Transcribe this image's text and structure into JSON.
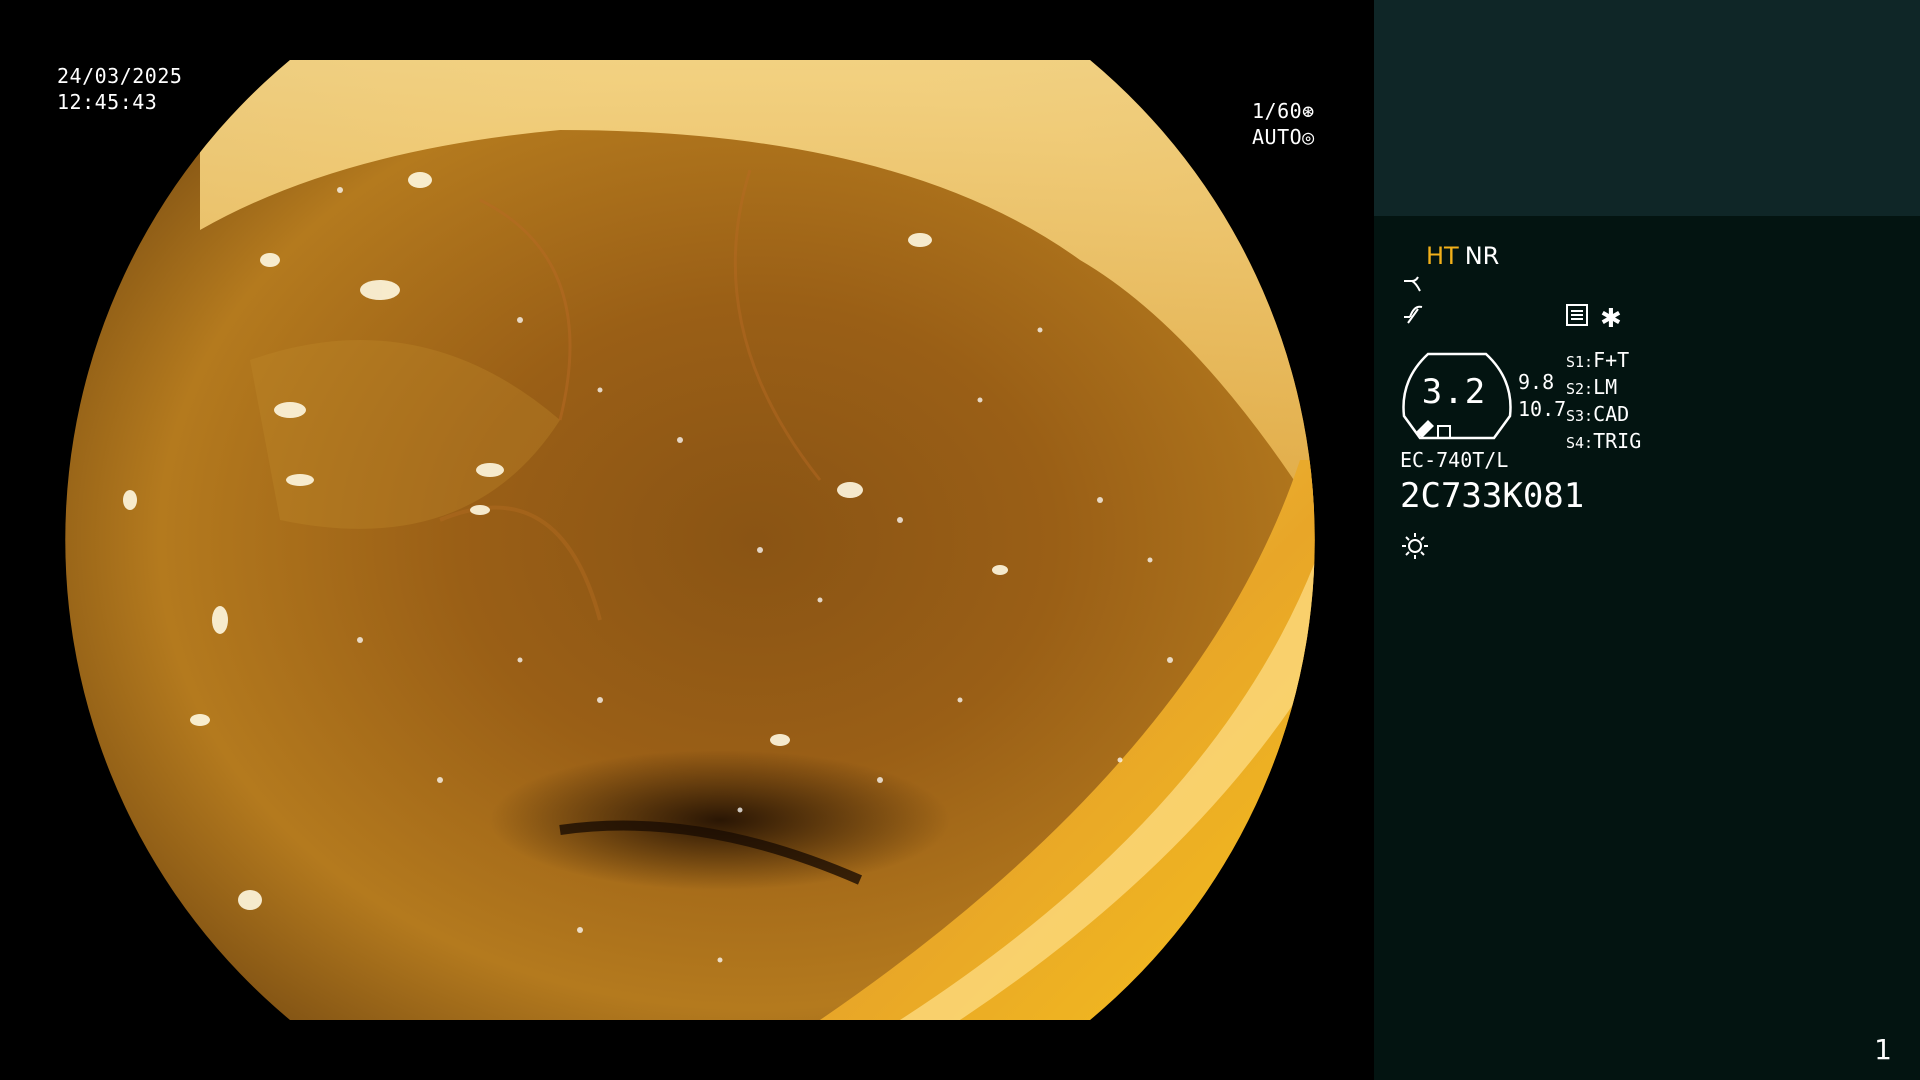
{
  "overlay": {
    "date": "24/03/2025",
    "time": "12:45:43",
    "shutter": "1/60",
    "iris": "AUTO"
  },
  "panel": {
    "mode_ht": "HT",
    "mode_nr": "NR",
    "zoom": "3.2",
    "param_1": "9.8",
    "param_2": "10.7",
    "switches": [
      {
        "key": "S1:",
        "value": "F+T"
      },
      {
        "key": "S2:",
        "value": "LM"
      },
      {
        "key": "S3:",
        "value": "CAD"
      },
      {
        "key": "S4:",
        "value": "TRIG"
      }
    ],
    "scope_model": "EC-740T/L",
    "scope_serial": "2C733K081",
    "frame_number": "1"
  },
  "icons": {
    "enhance": "enhancement-curve-icon",
    "structure": "structure-enhance-icon",
    "menu": "menu-list-icon",
    "asterisk": "asterisk-icon",
    "light": "light-source-icon",
    "shutter": "shutter-icon",
    "iris": "iris-icon"
  },
  "colors": {
    "panel_bg": "#031411",
    "panel_top": "#0f2627",
    "ht_accent": "#f2b01a"
  }
}
